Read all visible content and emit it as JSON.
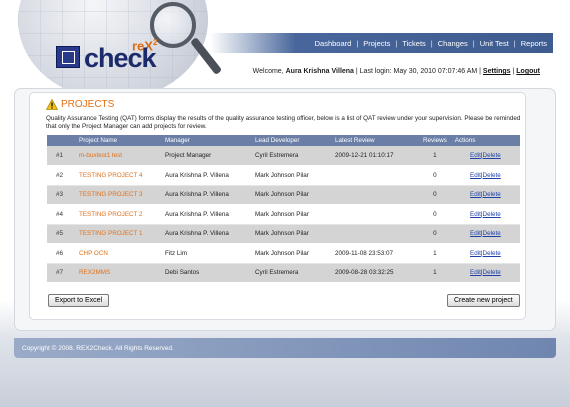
{
  "logo": {
    "rex": "reX",
    "superscript": "2",
    "check": "check"
  },
  "nav": [
    "Dashboard",
    "Projects",
    "Tickets",
    "Changes",
    "Unit Test",
    "Reports"
  ],
  "nav_separator": "|",
  "welcome": {
    "prefix": "Welcome,",
    "user": "Aura Krishna Villena",
    "last_login": "| Last login: May 30, 2010 07:07:46 AM |",
    "settings": "Settings",
    "pipe": "|",
    "logout": "Logout"
  },
  "section": {
    "title": "PROJECTS",
    "intro": "Quality Assurance Testing (QAT) forms display the results of the quality assurance testing officer, below is a list of QAT review under your supervision. Please be reminded that only the Project Manager can add projects for review."
  },
  "table": {
    "headers": [
      "",
      "Project Name",
      "Manager",
      "Lead Developer",
      "Latest Review",
      "Reviews",
      "Actions"
    ],
    "rows": [
      {
        "num": "#1",
        "name": "m-buxtest1 test",
        "manager": "Project Manager",
        "lead": "Cyril Estremera",
        "latest": "2009-12-21 01:10:17",
        "reviews": "1"
      },
      {
        "num": "#2",
        "name": "TESTING PROJECT 4",
        "manager": "Aura Krishna P. Villena",
        "lead": "Mark Johnson Pilar",
        "latest": "",
        "reviews": "0"
      },
      {
        "num": "#3",
        "name": "TESTING PROJECT 3",
        "manager": "Aura Krishna P. Villena",
        "lead": "Mark Johnson Pilar",
        "latest": "",
        "reviews": "0"
      },
      {
        "num": "#4",
        "name": "TESTING PROJECT 2",
        "manager": "Aura Krishna P. Villena",
        "lead": "Mark Johnson Pilar",
        "latest": "",
        "reviews": "0"
      },
      {
        "num": "#5",
        "name": "TESTING PROJECT 1",
        "manager": "Aura Krishna P. Villena",
        "lead": "Mark Johnson Pilar",
        "latest": "",
        "reviews": "0"
      },
      {
        "num": "#6",
        "name": "CHP OCN",
        "manager": "Fitz Lim",
        "lead": "Mark Johnson Pilar",
        "latest": "2009-11-08 23:53:07",
        "reviews": "1"
      },
      {
        "num": "#7",
        "name": "REX2MMS",
        "manager": "Debi Santos",
        "lead": "Cyril Estremera",
        "latest": "2009-08-28 03:32:25",
        "reviews": "1"
      }
    ],
    "edit_label": "Edit",
    "delete_label": "Delete",
    "action_sep": "|"
  },
  "buttons": {
    "export": "Export to Excel",
    "create": "Create new project"
  },
  "footer": "Copyright © 2008. REX2Check. All Rights Reserved.",
  "colors": {
    "accent": "#e07016",
    "nav": "#48669b",
    "table_header": "#6b7fa6",
    "link": "#1d3fa8"
  }
}
